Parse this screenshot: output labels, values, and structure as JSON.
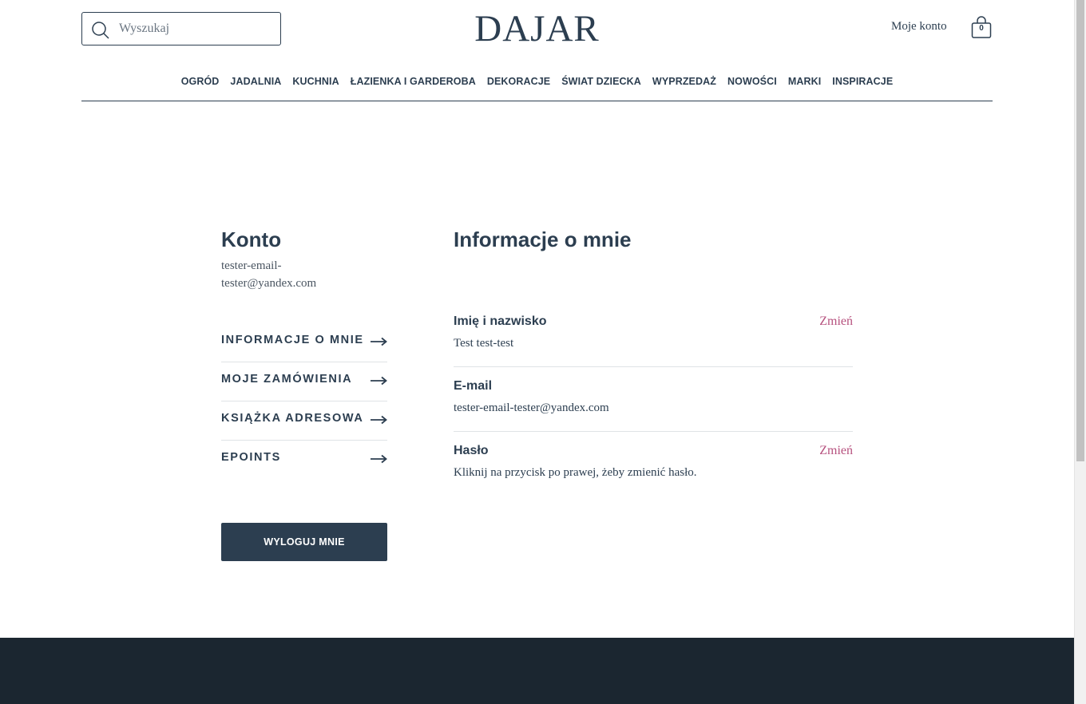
{
  "header": {
    "search": {
      "placeholder": "Wyszukaj"
    },
    "logo": "DAJAR",
    "account_label": "Moje konto",
    "cart_count": "0"
  },
  "nav": {
    "items": [
      "OGRÓD",
      "JADALNIA",
      "KUCHNIA",
      "ŁAZIENKA I GARDEROBA",
      "DEKORACJE",
      "ŚWIAT DZIECKA",
      "WYPRZEDAŻ",
      "NOWOŚCI",
      "MARKI",
      "INSPIRACJE"
    ]
  },
  "sidebar": {
    "title": "Konto",
    "email_line1": "tester-email-",
    "email_line2": "tester@yandex.com",
    "menu": [
      "INFORMACJE O MNIE",
      "MOJE ZAMÓWIENIA",
      "KSIĄŻKA ADRESOWA",
      "EPOINTS"
    ],
    "logout_label": "WYLOGUJ MNIE"
  },
  "main": {
    "title": "Informacje o mnie",
    "rows": [
      {
        "label": "Imię i nazwisko",
        "value": "Test test-test",
        "action": "Zmień"
      },
      {
        "label": "E-mail",
        "value": "tester-email-tester@yandex.com"
      },
      {
        "label": "Hasło",
        "value": "Kliknij na przycisk po prawej, żeby zmienić hasło.",
        "action": "Zmień"
      }
    ]
  },
  "colors": {
    "primary": "#2c3e50",
    "accent_link": "#b6517e",
    "footer": "#1b2630"
  }
}
